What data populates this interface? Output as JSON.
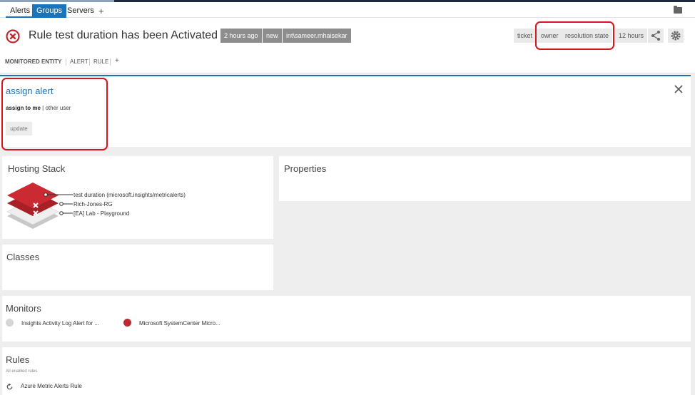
{
  "tabs": [
    {
      "label": "Alerts",
      "active": false
    },
    {
      "label": "Groups",
      "active": true
    },
    {
      "label": "Servers",
      "active": false
    },
    {
      "label": "+",
      "active": false
    }
  ],
  "header": {
    "title": "Rule test duration has been Activated",
    "status_icon": "error-circle-x-icon",
    "chips": {
      "age": "2 hours ago",
      "state": "new",
      "user": "int\\sameer.mhaisekar"
    },
    "right_chips": {
      "ticket": "ticket",
      "owner": "owner",
      "resolution": "resolution state",
      "hours": "12 hours"
    },
    "icons": [
      "share-icon",
      "gear-icon"
    ]
  },
  "subnav": {
    "items": [
      "MONITORED ENTITY",
      "ALERT",
      "RULE",
      "+"
    ]
  },
  "assign": {
    "title": "assign alert",
    "assign_me": "assign to me",
    "separator": "|",
    "other_user": "other user",
    "update_label": "update"
  },
  "hosting": {
    "title": "Hosting Stack",
    "items": [
      "test duration (microsoft.insights/metricalerts)",
      "Rich-Jones-RG",
      "[EA] Lab - Playground"
    ]
  },
  "properties": {
    "title": "Properties"
  },
  "classes": {
    "title": "Classes"
  },
  "monitors": {
    "title": "Monitors",
    "items": [
      {
        "label": "Insights Activity Log Alert for ...",
        "color": "#d6d6d6"
      },
      {
        "label": "Microsoft SystemCenter Micro...",
        "color": "#c1272d"
      }
    ]
  },
  "rules": {
    "title": "Rules",
    "subtitle": "All enabled rules",
    "items": [
      {
        "label": "Azure Metric Alerts Rule",
        "icon": "refresh-icon"
      }
    ]
  },
  "colors": {
    "accent": "#1b74ba",
    "error": "#c1272d",
    "highlight": "#d9141c"
  }
}
